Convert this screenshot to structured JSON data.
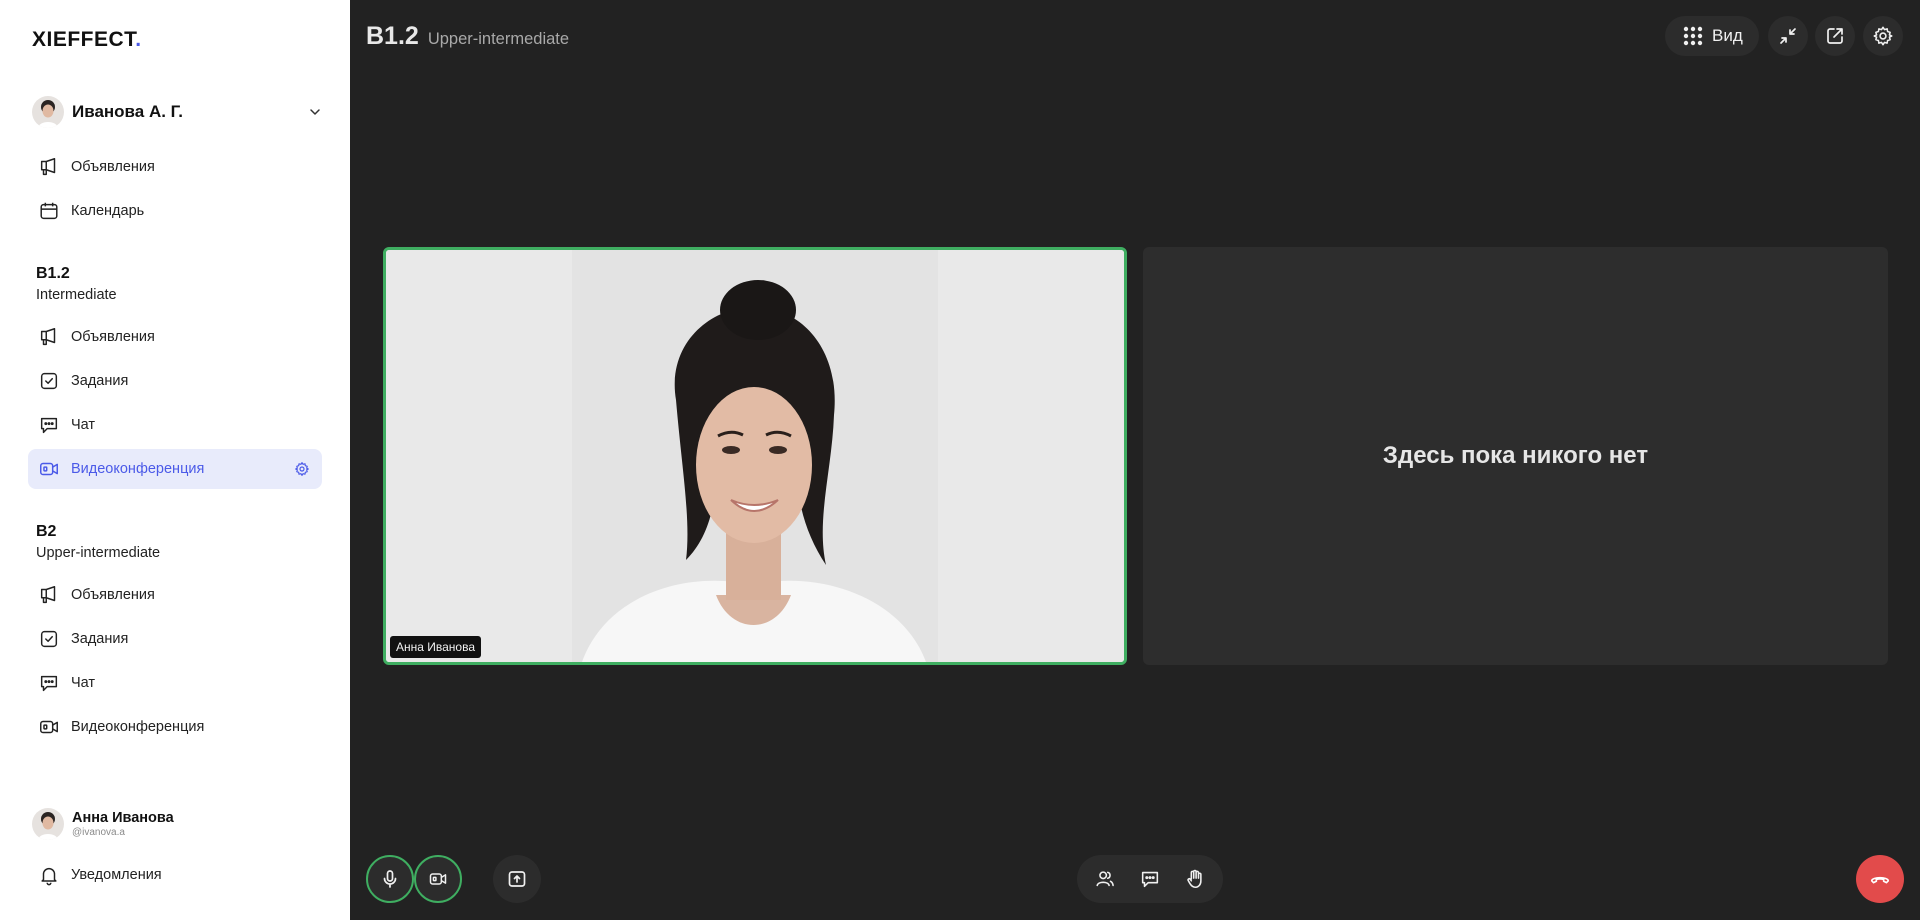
{
  "sidebar": {
    "logo_text": "XIEFFECT",
    "logo_dot": ".",
    "current_user": "Иванова А. Г.",
    "top_items": [
      {
        "label": "Объявления",
        "icon": "megaphone-icon"
      },
      {
        "label": "Календарь",
        "icon": "calendar-icon"
      }
    ],
    "groups": [
      {
        "title": "B1.2",
        "subtitle": "Intermediate",
        "items": [
          {
            "label": "Объявления",
            "icon": "megaphone-icon"
          },
          {
            "label": "Задания",
            "icon": "task-check-icon"
          },
          {
            "label": "Чат",
            "icon": "chat-icon"
          },
          {
            "label": "Видеоконференция",
            "icon": "video-call-icon",
            "active": true
          }
        ]
      },
      {
        "title": "B2",
        "subtitle": "Upper-intermediate",
        "items": [
          {
            "label": "Объявления",
            "icon": "megaphone-icon"
          },
          {
            "label": "Задания",
            "icon": "task-check-icon"
          },
          {
            "label": "Чат",
            "icon": "chat-icon"
          },
          {
            "label": "Видеоконференция",
            "icon": "video-call-icon"
          }
        ]
      }
    ],
    "profile": {
      "name": "Анна Иванова",
      "handle": "@ivanova.a"
    },
    "notifications_label": "Уведомления"
  },
  "header": {
    "course_code": "B1.2",
    "course_level": "Upper-intermediate",
    "view_label": "Вид"
  },
  "conference": {
    "participant_name": "Анна Иванова",
    "empty_message": "Здесь пока никого нет"
  },
  "colors": {
    "accent": "#4b5ae8",
    "active_bg": "#e8ebfb",
    "speaking_border": "#3fae61",
    "hangup": "#e24b4b",
    "main_bg": "#222222"
  }
}
